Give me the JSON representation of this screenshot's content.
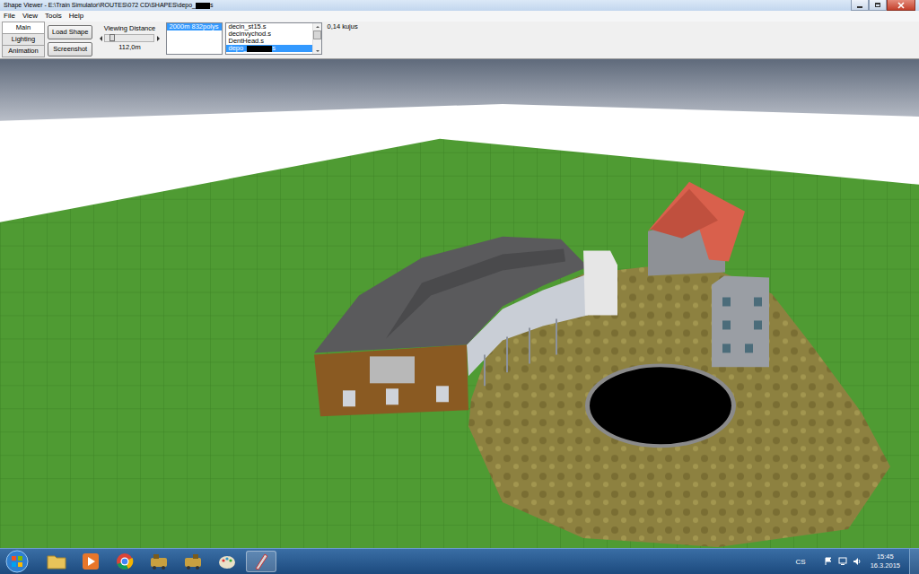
{
  "window": {
    "title": "Shape Viewer - E:\\Train Simulator\\ROUTES\\072 CD\\SHAPES\\depo_",
    "title_end": "s"
  },
  "menu": [
    "File",
    "View",
    "Tools",
    "Help"
  ],
  "tabs": [
    {
      "label": "Main",
      "selected": true
    },
    {
      "label": "Lighting",
      "selected": false
    },
    {
      "label": "Animation",
      "selected": false
    }
  ],
  "buttons": [
    "Load Shape",
    "Screenshot"
  ],
  "viewing_distance": {
    "label": "Viewing Distance",
    "level": 0.08,
    "reading": "112,0m"
  },
  "lod_list": [
    {
      "label": "2000m 832polys",
      "selected": true
    }
  ],
  "shape_list": [
    {
      "label": "decin_st15.s",
      "selected": false,
      "redacted": false,
      "end": ""
    },
    {
      "label": "decinvychod.s",
      "selected": false,
      "redacted": false,
      "end": ""
    },
    {
      "label": "DentHead.s",
      "selected": false,
      "redacted": false,
      "end": ""
    },
    {
      "label": "depo_",
      "selected": true,
      "redacted": true,
      "end": "s"
    }
  ],
  "fps": "0,14 kujus",
  "taskbar": {
    "language": "CS",
    "time": "15:45",
    "date": "16.3.2015"
  }
}
